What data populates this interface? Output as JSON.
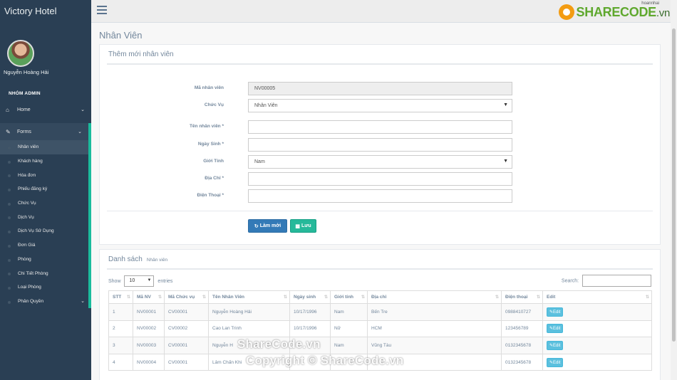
{
  "sidebar": {
    "brand": "Victory Hotel",
    "profile_name": "Nguyễn Hoàng Hải",
    "section_title": "NHÓM ADMIN",
    "home_label": "Home",
    "forms_label": "Forms",
    "sub_items": [
      "Nhân viên",
      "Khách hàng",
      "Hóa đơn",
      "Phiếu đăng ký",
      "Chức Vụ",
      "Dịch Vụ",
      "Dịch Vụ Sử Dụng",
      "Đơn Giá",
      "Phòng",
      "Chi Tiết Phòng",
      "Loại Phòng",
      "Phân Quyền"
    ]
  },
  "topnav": {
    "user": "hoannhai",
    "logo_main": "SHARECODE",
    "logo_suffix": ".vn"
  },
  "page": {
    "title": "Nhân Viên"
  },
  "form": {
    "title": "Thêm mới nhân viên",
    "fields": [
      {
        "label": "Mã nhân viên",
        "value": "NV00005"
      },
      {
        "label": "Chức Vụ",
        "value": "Nhân Viên"
      },
      {
        "label": "Tên nhân viên *",
        "value": ""
      },
      {
        "label": "Ngày Sinh *",
        "value": ""
      },
      {
        "label": "Giới Tính",
        "value": "Nam"
      },
      {
        "label": "Địa Chỉ *",
        "value": ""
      },
      {
        "label": "Điện Thoại *",
        "value": ""
      }
    ],
    "reset_label": "Làm mới",
    "save_label": "Lưu"
  },
  "list": {
    "title": "Danh sách",
    "subtitle": "Nhân viên",
    "show_label": "Show",
    "length_value": "10",
    "entries_label": "entries",
    "search_label": "Search:",
    "columns": [
      "STT",
      "Mã NV",
      "Mã Chức vụ",
      "Tên Nhân Viên",
      "Ngày sinh",
      "Giới tính",
      "Địa chỉ",
      "Điện thoại",
      "Edit"
    ],
    "edit_label": "Edit",
    "rows": [
      [
        "1",
        "NV00001",
        "CV00001",
        "Nguyễn Hoàng Hải",
        "10/17/1996",
        "Nam",
        "Bến Tre",
        "0988410727"
      ],
      [
        "2",
        "NV00002",
        "CV00002",
        "Cao Lan Trinh",
        "10/17/1996",
        "Nữ",
        "HCM",
        "123456789"
      ],
      [
        "3",
        "NV00003",
        "CV00001",
        "Nguyễn H",
        "",
        "Nam",
        "Vũng Tàu",
        "0132345678"
      ],
      [
        "4",
        "NV00004",
        "CV00001",
        "Lâm Chấn Khi",
        "",
        "",
        "",
        "0132345678"
      ]
    ]
  },
  "watermark": {
    "line1": "ShareCode.vn",
    "line2": "Copyright © ShareCode.vn"
  }
}
